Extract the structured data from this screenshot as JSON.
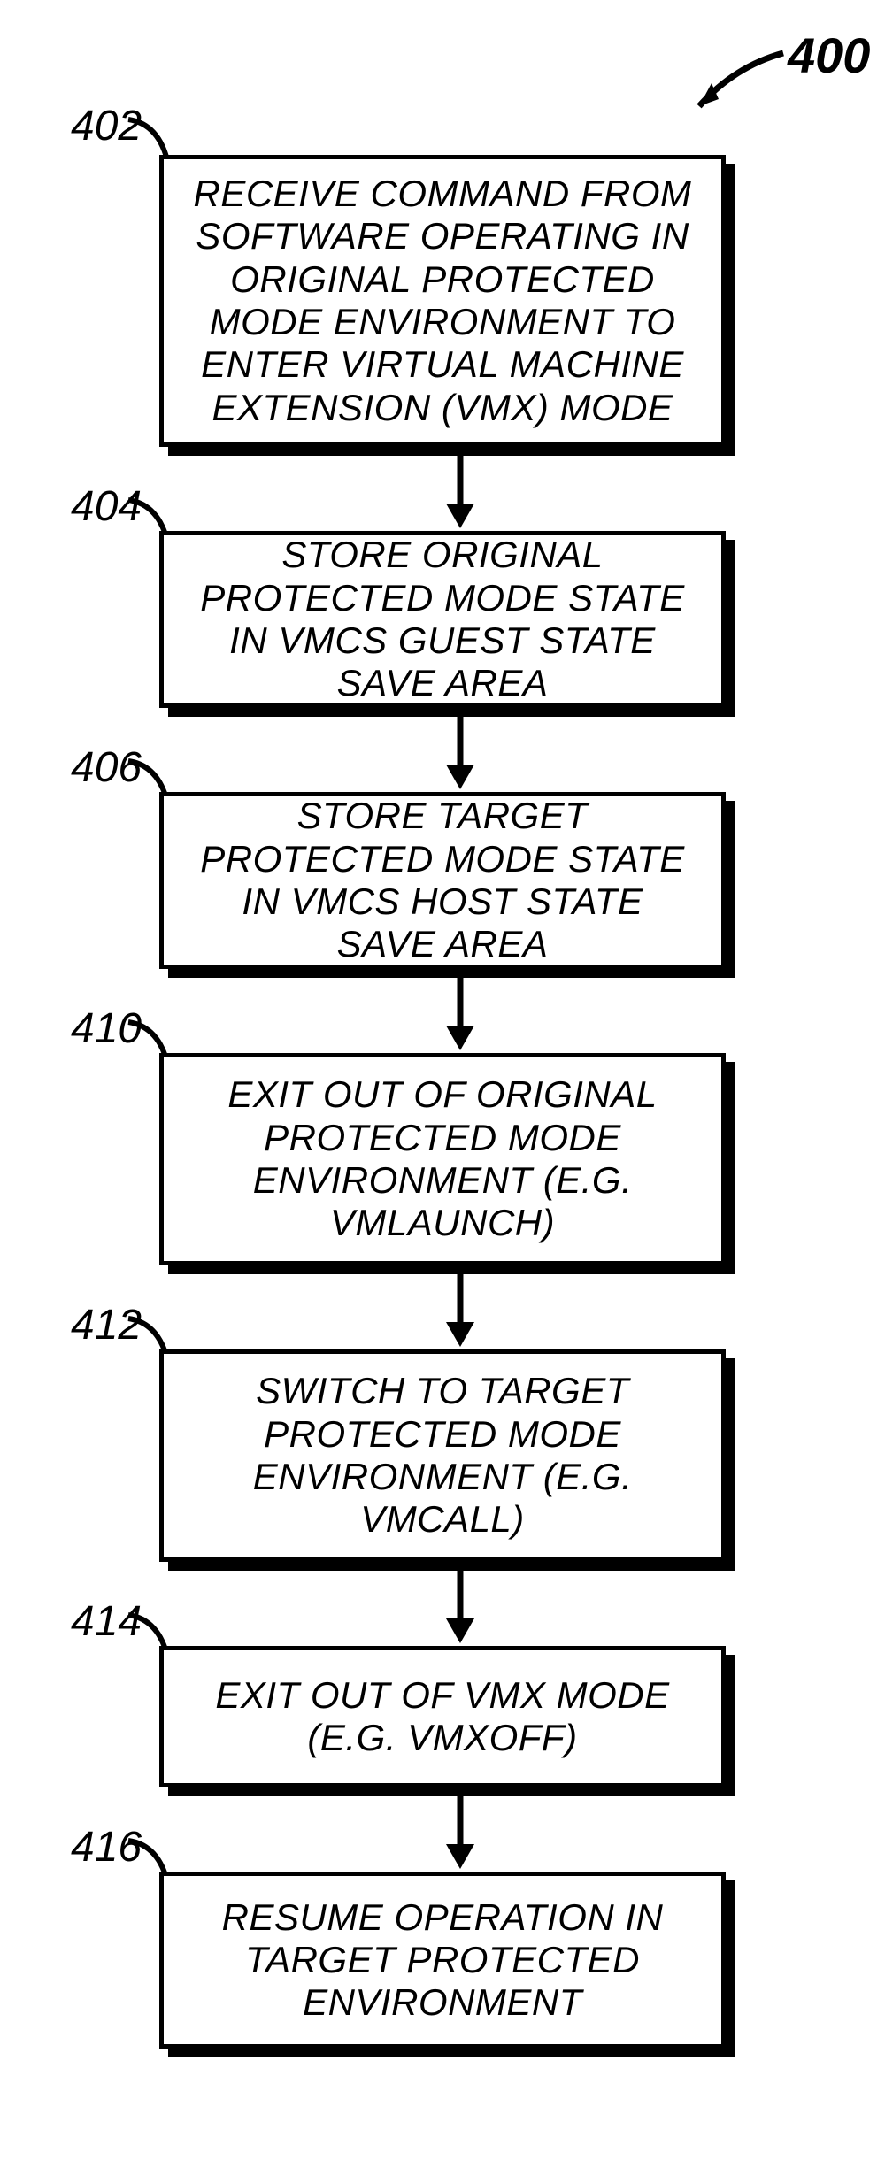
{
  "figure_ref": "400",
  "steps": [
    {
      "num": "402",
      "text": "RECEIVE COMMAND FROM SOFTWARE OPERATING IN ORIGINAL PROTECTED MODE ENVIRONMENT TO ENTER VIRTUAL MACHINE EXTENSION (VMX) MODE"
    },
    {
      "num": "404",
      "text": "STORE ORIGINAL PROTECTED MODE STATE IN VMCS GUEST STATE SAVE AREA"
    },
    {
      "num": "406",
      "text": "STORE TARGET PROTECTED MODE STATE IN VMCS HOST STATE SAVE AREA"
    },
    {
      "num": "410",
      "text": "EXIT OUT OF ORIGINAL PROTECTED MODE ENVIRONMENT (E.G. VMLAUNCH)"
    },
    {
      "num": "412",
      "text": "SWITCH TO TARGET PROTECTED MODE ENVIRONMENT (E.G. VMCALL)"
    },
    {
      "num": "414",
      "text": "EXIT OUT OF VMX MODE (E.G. VMXOFF)"
    },
    {
      "num": "416",
      "text": "RESUME OPERATION IN TARGET PROTECTED ENVIRONMENT"
    }
  ]
}
